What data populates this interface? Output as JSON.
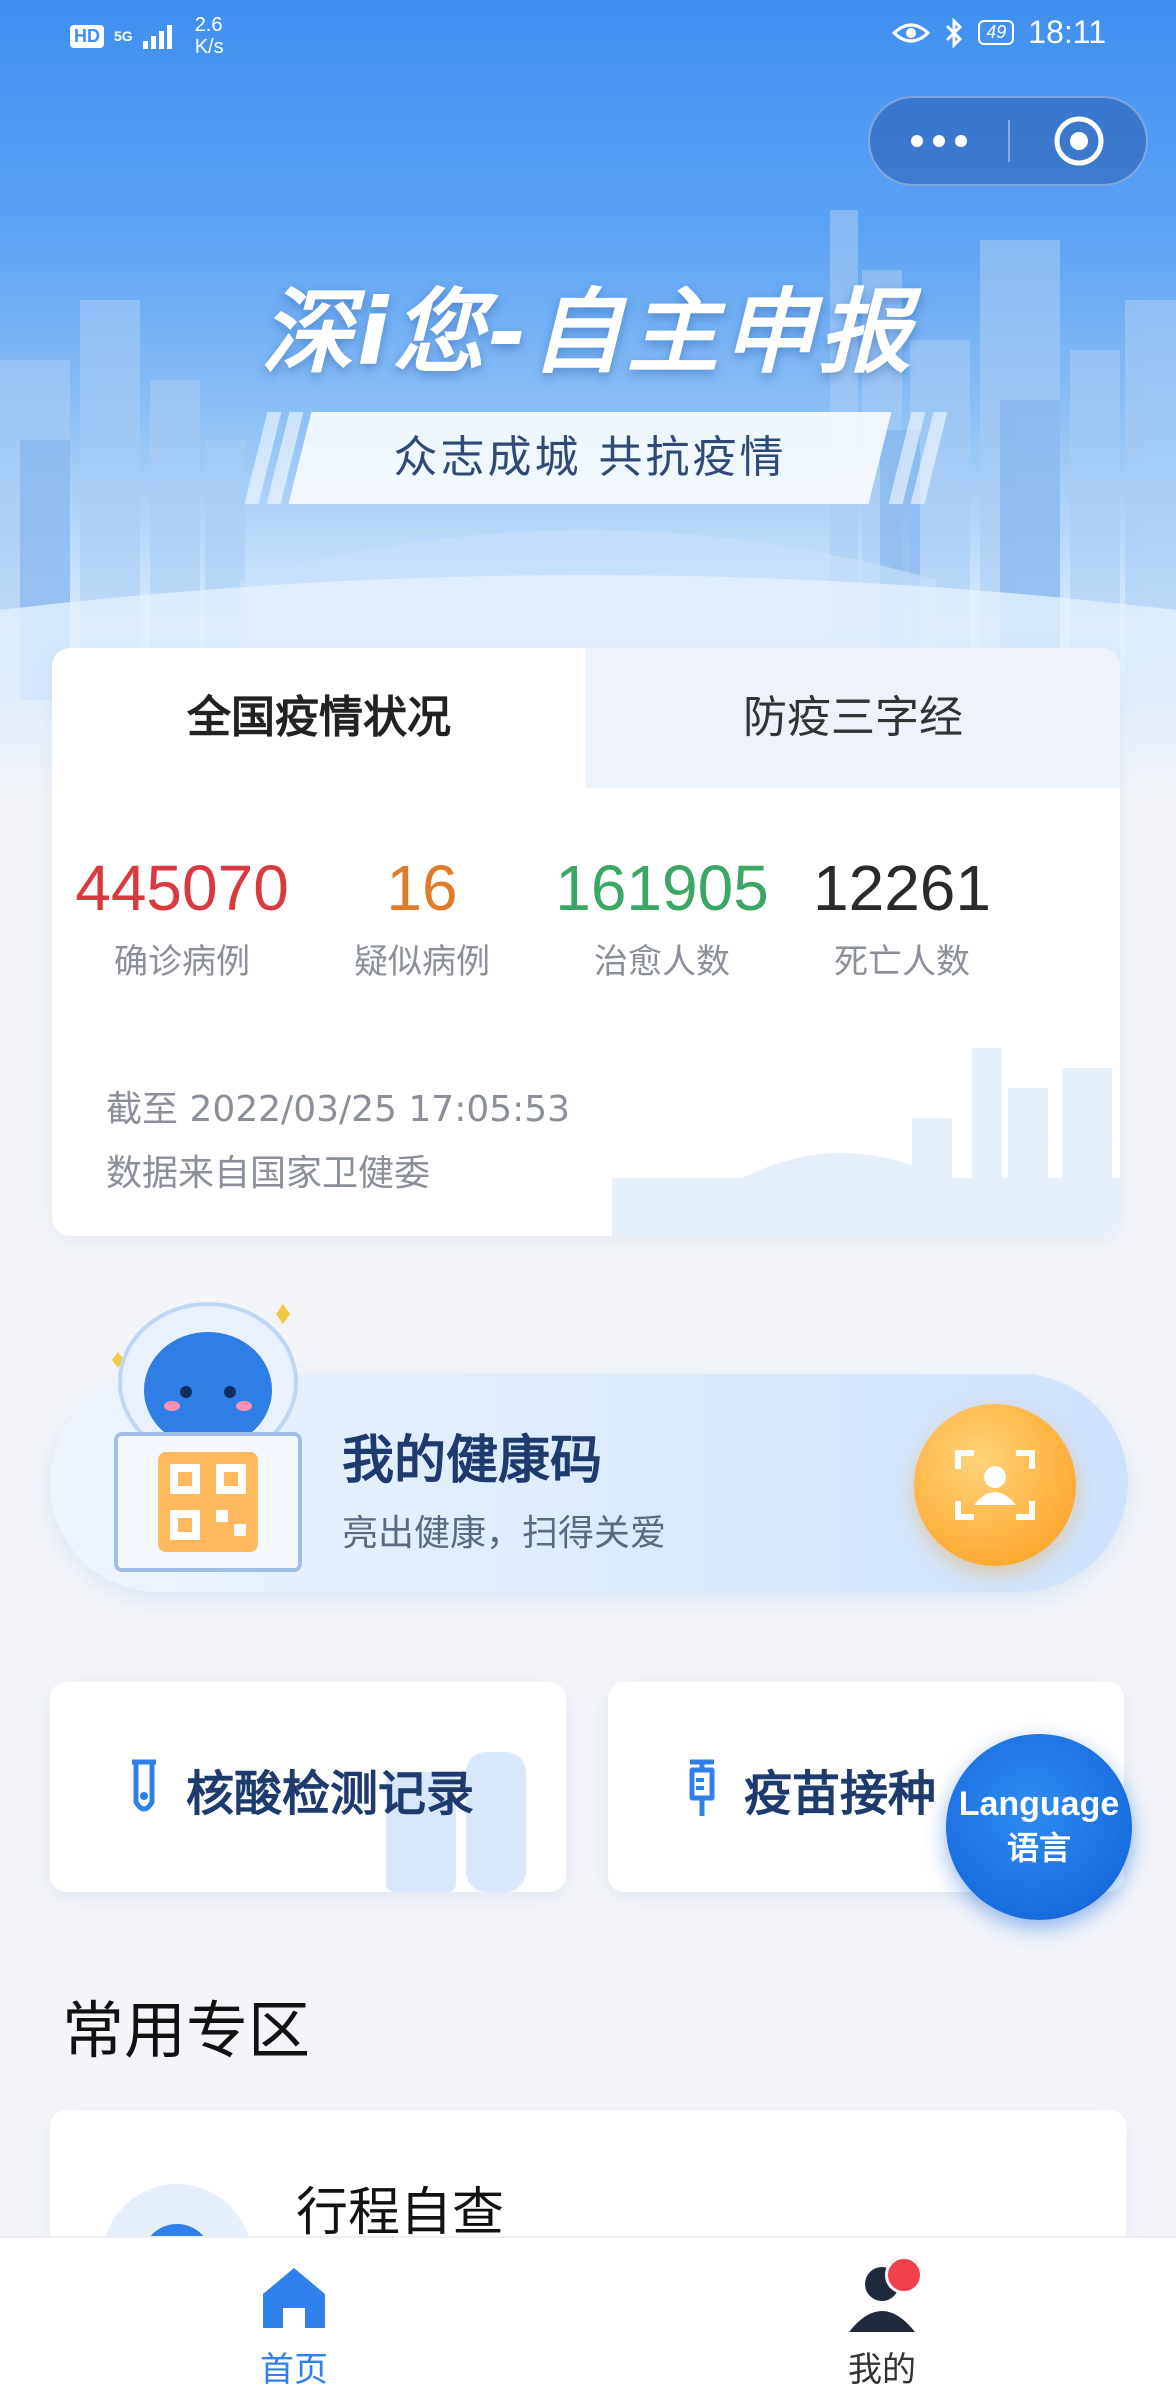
{
  "status_bar": {
    "hd": "HD",
    "network": "5G",
    "speed_value": "2.6",
    "speed_unit": "K/s",
    "battery": "49",
    "time": "18:11"
  },
  "hero": {
    "title": "深i您-自主申报",
    "slogan": "众志成城  共抗疫情"
  },
  "epidemic_card": {
    "tabs": [
      {
        "label": "全国疫情状况",
        "active": true
      },
      {
        "label": "防疫三字经",
        "active": false
      }
    ],
    "stats": [
      {
        "value": "445070",
        "label": "确诊病例",
        "color": "#d9393f"
      },
      {
        "value": "16",
        "label": "疑似病例",
        "color": "#e07b2a"
      },
      {
        "value": "161905",
        "label": "治愈人数",
        "color": "#3aa765"
      },
      {
        "value": "12261",
        "label": "死亡人数",
        "color": "#2a2a2a"
      }
    ],
    "as_of": "截至 2022/03/25 17:05:53",
    "source": "数据来自国家卫健委"
  },
  "health_code": {
    "title": "我的健康码",
    "subtitle": "亮出健康，扫得关爱"
  },
  "quick_links": [
    {
      "label": "核酸检测记录",
      "icon": "test-tube-icon"
    },
    {
      "label": "疫苗接种",
      "icon": "syringe-icon"
    }
  ],
  "language_button": {
    "en": "Language",
    "zh": "语言"
  },
  "common_zone": {
    "title": "常用专区",
    "items": [
      {
        "label": "行程自查"
      }
    ]
  },
  "bottom_nav": {
    "items": [
      {
        "label": "首页",
        "icon": "home-icon",
        "active": true
      },
      {
        "label": "我的",
        "icon": "user-icon",
        "active": false,
        "badge": true
      }
    ]
  },
  "colors": {
    "primary": "#2f80ea",
    "accent_orange": "#ffb23f",
    "title_navy": "#1f3a6e"
  }
}
